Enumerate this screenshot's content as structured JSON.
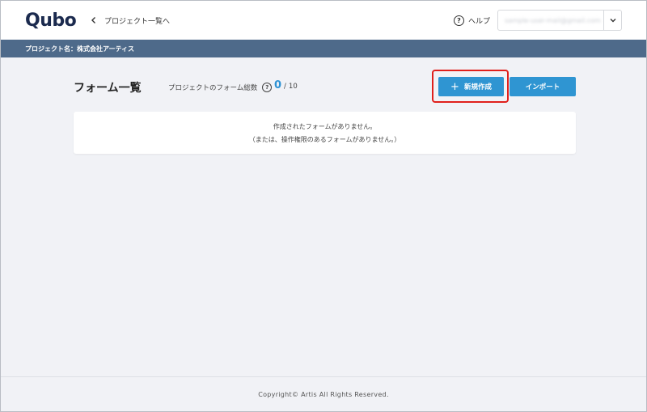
{
  "header": {
    "logo": "Qubo",
    "back_link": "プロジェクト一覧へ",
    "help_label": "ヘルプ",
    "account_email": "sample-user-mail@gmail.com"
  },
  "project_bar": {
    "label": "プロジェクト名：株式会社アーティス"
  },
  "main": {
    "title": "フォーム一覧",
    "count_label": "プロジェクトのフォーム総数",
    "count_current": "0",
    "count_separator": "/",
    "count_max": "10",
    "new_button": "新規作成",
    "import_button": "インポート",
    "empty_line1": "作成されたフォームがありません。",
    "empty_line2": "（または、操作権限のあるフォームがありません。）"
  },
  "footer": {
    "copyright": "Copyright© Artis All Rights Reserved."
  },
  "colors": {
    "accent": "#2f95d2",
    "project_bar": "#4e6a8a",
    "highlight": "#e0201c",
    "background": "#f1f2f6"
  }
}
